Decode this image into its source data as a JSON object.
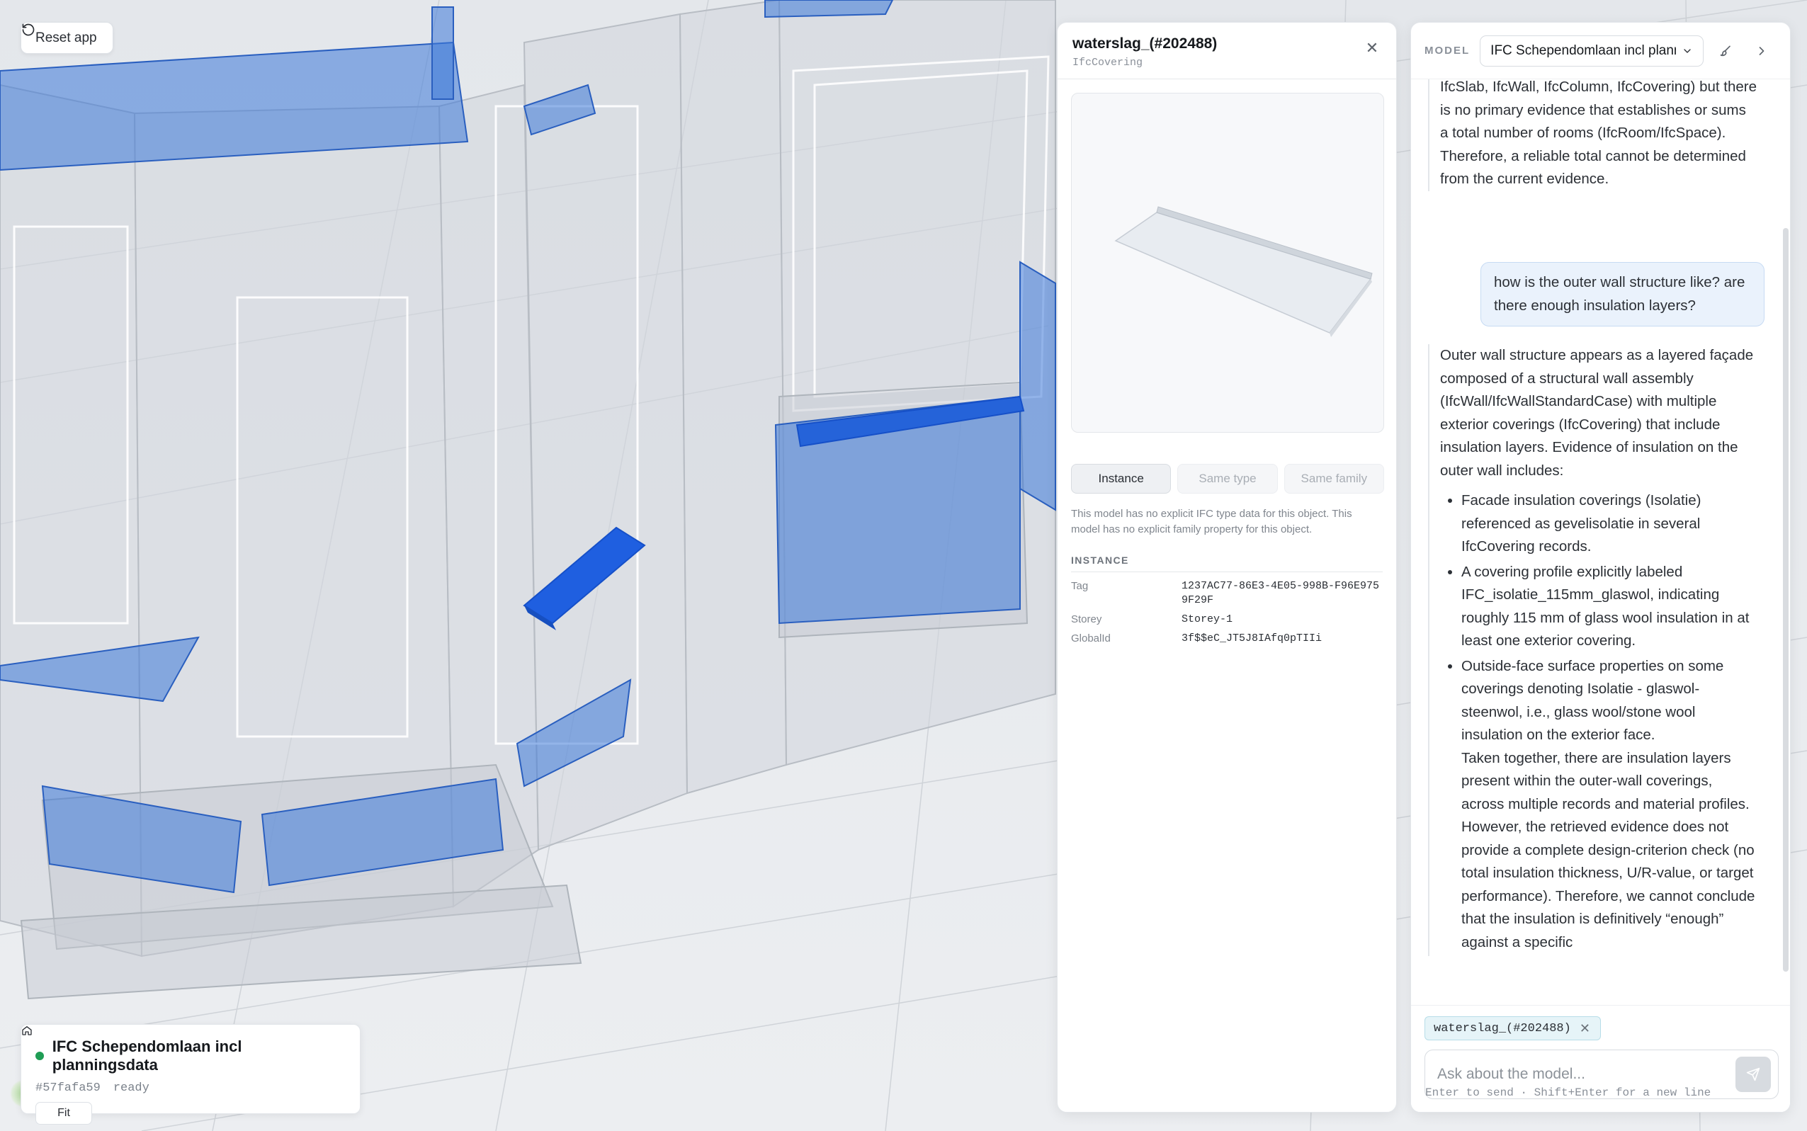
{
  "viewport": {
    "reset_button": "Reset app",
    "reset_icon": "rotate-ccw-icon",
    "model_card": {
      "name": "IFC Schependomlaan incl planningsdata",
      "hash": "#57fafa59",
      "status": "ready",
      "status_color": "#1f9d55",
      "fit_label": "Fit",
      "fit_icon": "home-icon"
    }
  },
  "properties": {
    "title": "waterslag_(#202488)",
    "type": "IfcCovering",
    "close_icon": "close-icon",
    "tabs": [
      {
        "label": "Instance",
        "active": true
      },
      {
        "label": "Same type",
        "active": false
      },
      {
        "label": "Same family",
        "active": false
      }
    ],
    "note": "This model has no explicit IFC type data for this object. This model has no explicit family property for this object.",
    "section": "INSTANCE",
    "rows": [
      {
        "key": "Tag",
        "value": "1237AC77-86E3-4E05-998B-F96E9759F29F"
      },
      {
        "key": "Storey",
        "value": "Storey-1"
      },
      {
        "key": "GlobalId",
        "value": "3f$$eC_JT5J8IAfq0pTIIi"
      }
    ]
  },
  "chat": {
    "model_label": "MODEL",
    "model_select": "IFC Schependomlaan incl planningsdata",
    "messages": {
      "ai_1": "IfcSlab, IfcWall, IfcColumn, IfcCovering) but there is no primary evidence that establishes or sums a total number of rooms (IfcRoom/IfcSpace). Therefore, a reliable total cannot be determined from the current evidence.",
      "user_1": "how is the outer wall structure like? are there enough insulation layers?",
      "ai_2_intro": "Outer wall structure appears as a layered façade composed of a structural wall assembly (IfcWall/IfcWallStandardCase) with multiple exterior coverings (IfcCovering) that include insulation layers. Evidence of insulation on the outer wall includes:",
      "ai_2_bullets": [
        "Facade insulation coverings (Isolatie) referenced as gevelisolatie in several IfcCovering records.",
        "A covering profile explicitly labeled IFC_isolatie_115mm_glaswol, indicating roughly 115 mm of glass wool insulation in at least one exterior covering.",
        "Outside-face surface properties on some coverings denoting Isolatie - glaswol-steenwol, i.e., glass wool/stone wool insulation on the exterior face."
      ],
      "ai_2_conclusion": "Taken together, there are insulation layers present within the outer-wall coverings, across multiple records and material profiles. However, the retrieved evidence does not provide a complete design-criterion check (no total insulation thickness, U/R-value, or target performance). Therefore, we cannot conclude that the insulation is definitively “enough” against a specific"
    },
    "chip": "waterslag_(#202488)",
    "input_placeholder": "Ask about the model...",
    "hint": "Enter to send · Shift+Enter for a new line",
    "send_icon": "send-icon"
  },
  "colors": {
    "accent_blue": "#2f6fd6",
    "selected_blue": "#1f5fe0",
    "user_bubble": "#eaf2fc",
    "chip_bg": "#e6f4f8"
  }
}
